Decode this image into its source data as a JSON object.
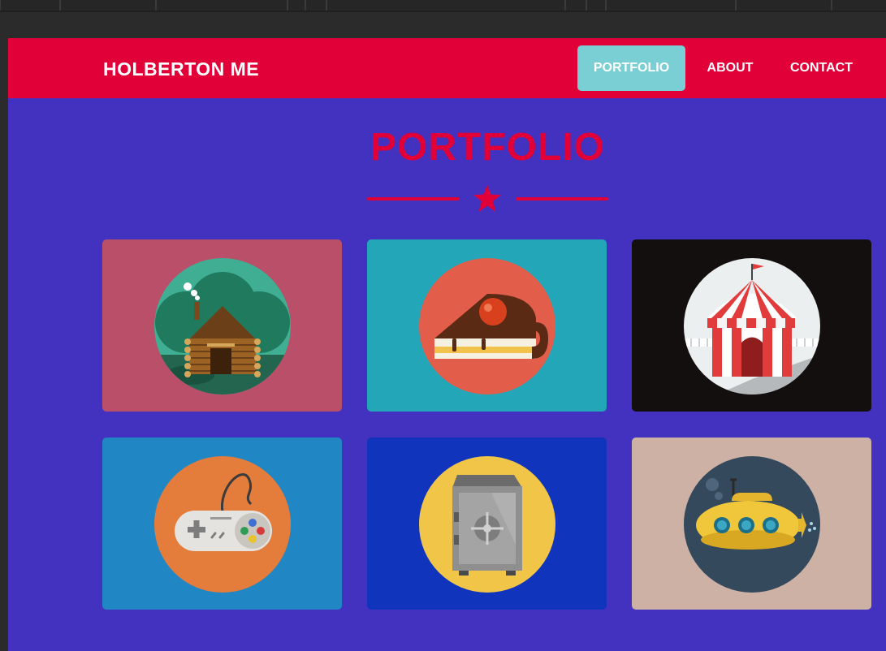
{
  "brand": {
    "name": "HOLBERTON ME"
  },
  "nav": {
    "items": [
      {
        "label": "PORTFOLIO",
        "active": true
      },
      {
        "label": "ABOUT",
        "active": false
      },
      {
        "label": "CONTACT",
        "active": false
      }
    ]
  },
  "portfolio": {
    "title": "PORTFOLIO",
    "items": [
      {
        "icon": "log-cabin-icon",
        "background": "#b94f68"
      },
      {
        "icon": "cake-slice-icon",
        "background": "#22a6b8"
      },
      {
        "icon": "circus-tent-icon",
        "background": "#140f0f"
      },
      {
        "icon": "game-controller-icon",
        "background": "#2186c4"
      },
      {
        "icon": "safe-icon",
        "background": "#1034bb"
      },
      {
        "icon": "submarine-icon",
        "background": "#cdb1a4"
      }
    ]
  },
  "colors": {
    "accent": "#e10037",
    "page_background": "#4232bf",
    "active_nav": "#79cfd3"
  }
}
